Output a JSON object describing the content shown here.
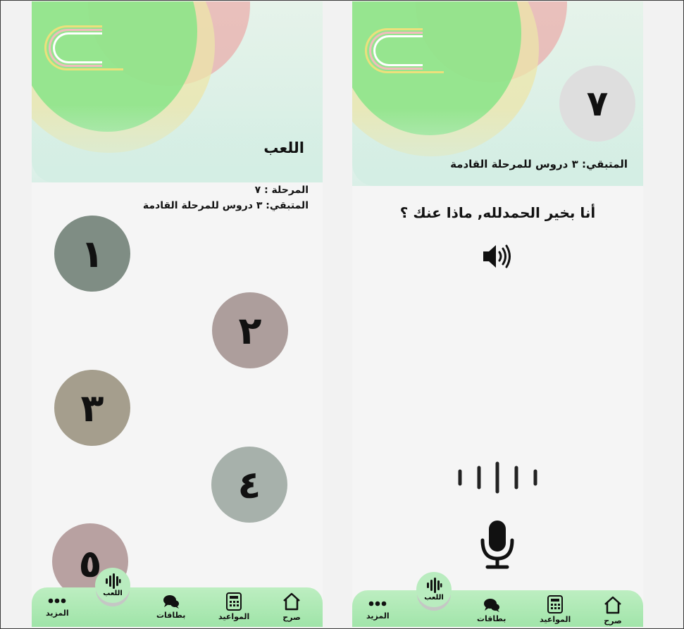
{
  "left_screen": {
    "title": "اللعب",
    "stage_line": "المرحلة : ٧",
    "remaining_line": "المتبقي: ٣ دروس للمرحلة القادمة",
    "levels": [
      "١",
      "٢",
      "٣",
      "٤",
      "٥"
    ]
  },
  "right_screen": {
    "level_number": "٧",
    "remaining_line": "المتبقي: ٣ دروس للمرحلة القادمة",
    "phrase": "أنا بخير الحمدلله, ماذا عنك ؟"
  },
  "nav": {
    "home": "صرح",
    "appointments": "المواعيد",
    "cards": "بطاقات",
    "play": "اللعب",
    "more": "المزيد"
  },
  "icons": {
    "home": "home-icon",
    "appointments": "calculator-icon",
    "cards": "chat-bubbles-icon",
    "play": "soundwave-icon",
    "more": "more-dots-icon",
    "speaker": "speaker-icon",
    "waveform": "waveform-icon",
    "mic": "microphone-icon",
    "logo": "app-logo"
  },
  "colors": {
    "nav_bg": "#a8e6ae",
    "level_1": "#7f8d84",
    "level_2": "#ad9e9c",
    "level_3": "#a59e8d",
    "level_4": "#a7b1ab",
    "level_5": "#b8a1a1",
    "level_badge": "#dedede"
  }
}
